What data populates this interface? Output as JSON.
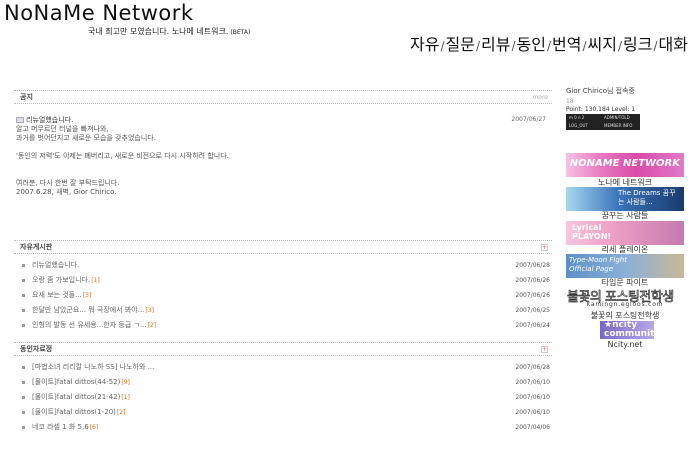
{
  "header": {
    "logo": "NoNaMe Network",
    "tagline": "국내 최고만 모였습니다. 노나메 네트워크.",
    "tagline_small": "(BETA)"
  },
  "nav": {
    "items": [
      "자유",
      "질문",
      "리뷰",
      "동인",
      "번역",
      "씨지",
      "링크",
      "대화"
    ],
    "separator": "/"
  },
  "notice": {
    "title": "공지",
    "more": "more",
    "post_title": "리뉴얼했습니다.",
    "date": "2007/06/27",
    "lines": [
      "알고 머무르던 터널을 빠져나와,",
      "과거를 벗어던지고 새로운 모습을 갖추었습니다.",
      "",
      "'동인의 저력'도 이제는 폐버리고, 새로운 비전으로 다시 시작하려 합니다.",
      "",
      "",
      "여러분, 다시 한번 잘 부탁드립니다.",
      "2007.6.28, 새벽, Gior Chirico."
    ]
  },
  "free_board": {
    "title": "자유게시판",
    "posts": [
      {
        "title": "리뉴얼했습니다.",
        "count": "",
        "date": "2007/06/28"
      },
      {
        "title": "오랑 좀 가보입니다.",
        "count": "[1]",
        "date": "2007/06/26"
      },
      {
        "title": "요새 보는 것들...",
        "count": "[3]",
        "date": "2007/06/26"
      },
      {
        "title": "한달만 남았군요... 뭐 극장에서 봐야...",
        "count": "[3]",
        "date": "2007/06/25"
      },
      {
        "title": "인형의 발동 선 유세용...한자 등급 ㄱ...",
        "count": "[2]",
        "date": "2007/06/24"
      }
    ]
  },
  "data_board": {
    "title": "동인자료정",
    "posts": [
      {
        "title": "[마법소녀 리리칼 나노하 SS] 나노하와 ...",
        "count": "",
        "date": "2007/06/28"
      },
      {
        "title": "[물이트]fatal dittos(44-52)",
        "count": "[9]",
        "date": "2007/06/10"
      },
      {
        "title": "[물이트]fatal dittos(21-42)",
        "count": "[1]",
        "date": "2007/06/10"
      },
      {
        "title": "[물이트]fatal dittos(1-20)",
        "count": "[2]",
        "date": "2007/06/10"
      },
      {
        "title": "네코 라셀 1 화 5,6",
        "count": "[6]",
        "date": "2007/04/06"
      }
    ]
  },
  "sidebar": {
    "greeting": "Gior Chirico님 접속중",
    "small": "18",
    "point_label": "Point: 130,184  Level: 1",
    "login_items": [
      "m  0    n  2",
      "ADMIN/TOLD",
      "LOG_OUT",
      "MEMBER INFO"
    ],
    "banners": [
      {
        "text": "NONAME NETWORK",
        "caption": "노나메 네트워크"
      },
      {
        "text": "The Dreams  꿈꾸는 사람들...",
        "caption": "꿈꾸는 사람들"
      },
      {
        "text": "Lyrical PLAYON!",
        "caption": "리세 플레이온"
      },
      {
        "text": "Type-Moon Fight Official Page",
        "caption": "타입문 파이트"
      },
      {
        "text": "불꽃의 포스팅전학생",
        "sub": "kamingn.egloos.com",
        "caption": "불꽃의 포스팅전학생"
      },
      {
        "text": "★ncity community",
        "caption": "Ncity.net"
      }
    ]
  }
}
